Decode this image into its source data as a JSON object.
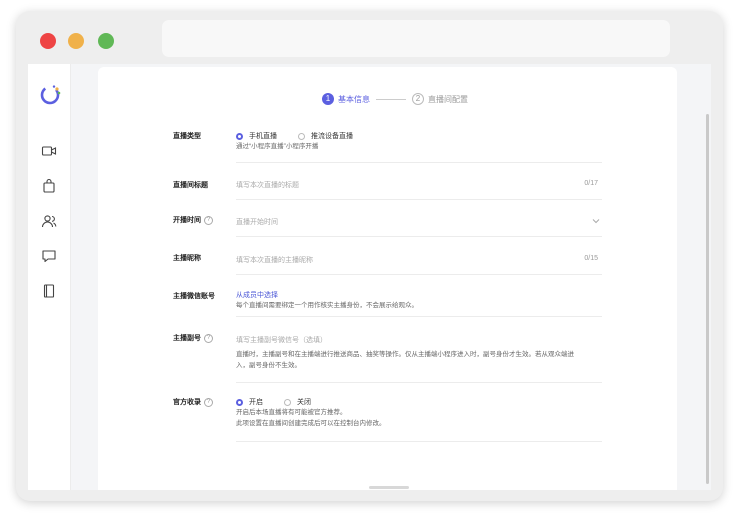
{
  "form": {
    "steps": [
      {
        "number": "1",
        "label": "基本信息"
      },
      {
        "number": "2",
        "label": "直播间配置"
      }
    ],
    "live_type": {
      "label": "直播类型",
      "options": [
        "手机直播",
        "推流设备直播"
      ],
      "selected": "手机直播",
      "hint": "通过“小程序直播”小程序开播"
    },
    "title": {
      "label": "直播间标题",
      "placeholder": "填写本次直播的标题",
      "counter": "0/17"
    },
    "start_time": {
      "label": "开播时间",
      "placeholder": "直播开始时间"
    },
    "host_nickname": {
      "label": "主播昵称",
      "placeholder": "填写本次直播的主播昵称",
      "counter": "0/15"
    },
    "host_wechat": {
      "label": "主播微信账号",
      "link": "从成员中选择",
      "hint": "每个直播间需要绑定一个用作核实主播身份，不会展示给观众。"
    },
    "assistant": {
      "label": "主播副号",
      "placeholder": "填写主播副号微信号（选填）",
      "hint_line1": "直播时，主播副号和在主播端进行推送商品、抽奖等操作。仅从主播端小程序进入时，副号身份才生效。若从观众端进",
      "hint_line2": "入，副号身份不生效。"
    },
    "official_collect": {
      "label": "官方收录",
      "options": [
        "开启",
        "关闭"
      ],
      "selected": "开启",
      "hint_line1": "开启后本场直播将有可能被官方推荐。",
      "hint_line2": "此项设置在直播间创建完成后可以在控制台内修改。"
    }
  },
  "icons": {
    "help": "question-mark"
  },
  "colors": {
    "accent": "#5b5fe0",
    "link": "#4a56d6"
  }
}
